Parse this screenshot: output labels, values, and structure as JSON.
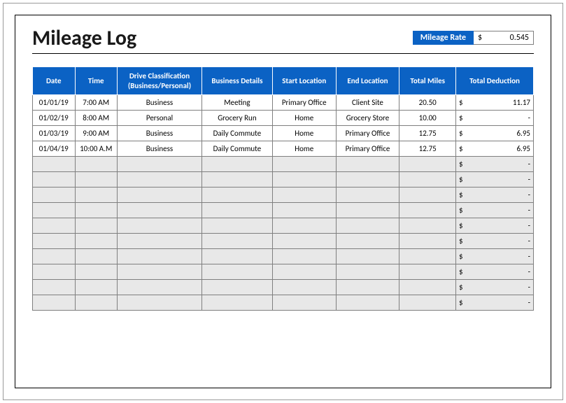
{
  "title": "Mileage Log",
  "rate": {
    "label": "Mileage Rate",
    "currency": "$",
    "value": "0.545"
  },
  "columns": [
    "Date",
    "Time",
    "Drive Classification (Business/Personal)",
    "Business Details",
    "Start Location",
    "End Location",
    "Total Miles",
    "Total Deduction"
  ],
  "currency": "$",
  "null_deduction": "-",
  "rows": [
    {
      "date": "01/01/19",
      "time": "7:00 AM",
      "class": "Business",
      "details": "Meeting",
      "start": "Primary Office",
      "end": "Client Site",
      "miles": "20.50",
      "deduction": "11.17"
    },
    {
      "date": "01/02/19",
      "time": "8:00 AM",
      "class": "Personal",
      "details": "Grocery Run",
      "start": "Home",
      "end": "Grocery Store",
      "miles": "10.00",
      "deduction": "-"
    },
    {
      "date": "01/03/19",
      "time": "9:00 AM",
      "class": "Business",
      "details": "Daily Commute",
      "start": "Home",
      "end": "Primary Office",
      "miles": "12.75",
      "deduction": "6.95"
    },
    {
      "date": "01/04/19",
      "time": "10:00 A.M",
      "class": "Business",
      "details": "Daily Commute",
      "start": "Home",
      "end": "Primary Office",
      "miles": "12.75",
      "deduction": "6.95"
    }
  ],
  "empty_row_count": 10
}
